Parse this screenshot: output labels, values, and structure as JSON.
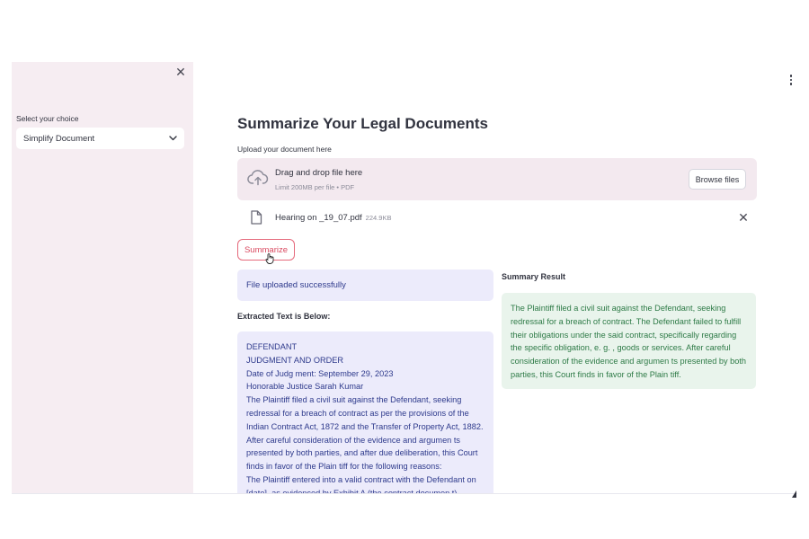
{
  "sidebar": {
    "close_icon": "close-icon",
    "select_label": "Select your choice",
    "select_value": "Simplify Document",
    "select_icon": "chevron-down-icon"
  },
  "header": {
    "menu_icon": "kebab-menu-icon"
  },
  "main": {
    "title": "Summarize Your Legal Documents",
    "upload_label": "Upload your document here",
    "dropzone": {
      "icon": "cloud-upload-icon",
      "title": "Drag and drop file here",
      "subtitle": "Limit 200MB per file • PDF",
      "browse_label": "Browse files"
    },
    "uploaded_file": {
      "icon": "file-icon",
      "name": "Hearing on _19_07.pdf",
      "size": "224.9KB",
      "remove_icon": "close-icon"
    },
    "summarize_label": "Summarize",
    "success_message": "File uploaded successfully",
    "extracted_heading": "Extracted Text is Below:",
    "extracted_lines": [
      "DEFENDANT",
      "JUDGMENT AND ORDER",
      "Date of Judg ment: September 29, 2023",
      "Honorable Justice Sarah Kumar",
      "The Plaintiff filed a civil suit against the Defendant, seeking",
      "redressal for a breach of contract as per the provisions of the",
      "Indian Contract Act, 1872 and the Transfer of Property Act, 1882.",
      "After careful consideration of the evidence and argumen ts",
      "presented by both parties, and after due deliberation, this Court",
      "finds in favor of the Plain tiff for the following reasons:",
      "The Plaintiff entered into a valid contract with the Defendant on",
      "[date], as evidenced by Exhibit A (the contract documen t)."
    ],
    "summary_heading": "Summary Result",
    "summary_lines": [
      "The Plaintiff filed a civil suit against the Defendant, seeking",
      "redressal for a breach of contract. The Defendant failed to fulfill",
      "their obligations under the said contract, specifically regarding",
      "the specific obligation, e. g. , goods or services. After careful",
      "consideration of the evidence and argumen ts presented by both",
      "parties, this Court finds in favor of the Plain tiff."
    ]
  },
  "colors": {
    "sidebar_bg": "#f6edf2",
    "dropzone_bg": "#f3e9ef",
    "accent": "#e56a7c",
    "info_bg": "#ecebfb",
    "info_text": "#2e3a8c",
    "success_bg": "#e9f4ec",
    "success_text": "#2d7a46"
  }
}
